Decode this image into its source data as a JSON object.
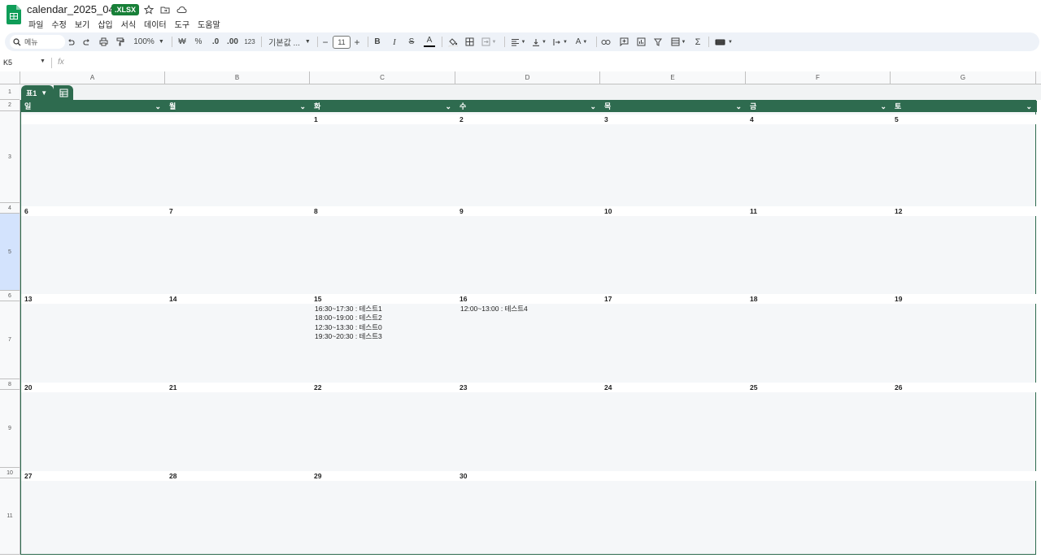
{
  "title_bar": {
    "doc_title": "calendar_2025_04",
    "badge": ".XLSX"
  },
  "menu": [
    "파일",
    "수정",
    "보기",
    "삽입",
    "서식",
    "데이터",
    "도구",
    "도움말"
  ],
  "toolbar": {
    "search_label": "메뉴",
    "zoom": "100%",
    "currency": "₩",
    "percent": "%",
    "dec_decrease": ".0",
    "dec_increase": ".00",
    "number_format": "123",
    "font": "기본값 ...",
    "font_size": "11",
    "bold": "B",
    "italic": "I",
    "strike": "S",
    "text_color": "A",
    "sigma": "Σ"
  },
  "formula_bar": {
    "cell_ref": "K5",
    "fx": "fx"
  },
  "columns": [
    "A",
    "B",
    "C",
    "D",
    "E",
    "F",
    "G"
  ],
  "rows": [
    "1",
    "2",
    "3",
    "4",
    "5",
    "6",
    "7",
    "8",
    "9",
    "10",
    "11"
  ],
  "table_name": "표1",
  "weekdays": [
    "일",
    "월",
    "화",
    "수",
    "목",
    "금",
    "토"
  ],
  "weeks": [
    [
      "",
      "",
      "1",
      "2",
      "3",
      "4",
      "5"
    ],
    [
      "6",
      "7",
      "8",
      "9",
      "10",
      "11",
      "12"
    ],
    [
      "13",
      "14",
      "15",
      "16",
      "17",
      "18",
      "19"
    ],
    [
      "20",
      "21",
      "22",
      "23",
      "24",
      "25",
      "26"
    ],
    [
      "27",
      "28",
      "29",
      "30",
      "",
      "",
      ""
    ]
  ],
  "events": {
    "c15": [
      "16:30~17:30 : 테스트1",
      "18:00~19:00 : 테스트2",
      "12:30~13:30 : 테스트0",
      "19:30~20:30 : 테스트3"
    ],
    "d16": [
      "12:00~13:00 : 테스트4"
    ]
  },
  "colors": {
    "table_green": "#2e6b4f",
    "badge_green": "#188038",
    "toolbar_bg": "#eef2f8"
  }
}
